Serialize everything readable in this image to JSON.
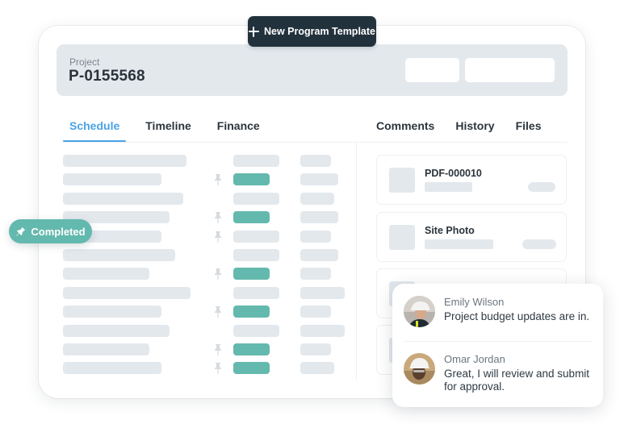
{
  "toolbar": {
    "new_template_label": "New Program Template",
    "new_template_icon": "plus-icon"
  },
  "project": {
    "label": "Project",
    "id": "P-0155568"
  },
  "tabs_left": [
    {
      "label": "Schedule",
      "active": true
    },
    {
      "label": "Timeline",
      "active": false
    },
    {
      "label": "Finance",
      "active": false
    }
  ],
  "tabs_right": [
    {
      "label": "Comments",
      "active": false
    },
    {
      "label": "History",
      "active": false
    },
    {
      "label": "Files",
      "active": false
    }
  ],
  "badge": {
    "label": "Completed",
    "icon": "pin-icon",
    "color": "#64b9ae"
  },
  "schedule_rows": [
    {
      "pinned": false,
      "completed": false
    },
    {
      "pinned": true,
      "completed": true
    },
    {
      "pinned": false,
      "completed": false
    },
    {
      "pinned": true,
      "completed": true
    },
    {
      "pinned": true,
      "completed": false
    },
    {
      "pinned": false,
      "completed": false
    },
    {
      "pinned": true,
      "completed": true
    },
    {
      "pinned": false,
      "completed": false
    },
    {
      "pinned": true,
      "completed": true
    },
    {
      "pinned": false,
      "completed": false
    },
    {
      "pinned": true,
      "completed": true
    },
    {
      "pinned": true,
      "completed": true
    }
  ],
  "files": [
    {
      "name": "PDF-000010"
    },
    {
      "name": "Site Photo"
    },
    {
      "name": ""
    },
    {
      "name": ""
    }
  ],
  "comments": [
    {
      "author": "Emily Wilson",
      "text": "Project budget updates are in."
    },
    {
      "author": "Omar Jordan",
      "text": "Great, I will review and submit for approval."
    }
  ],
  "colors": {
    "accent": "#4aa3e6",
    "completed": "#64b9ae",
    "dark_button": "#22323d",
    "placeholder": "#e3e8ed"
  }
}
